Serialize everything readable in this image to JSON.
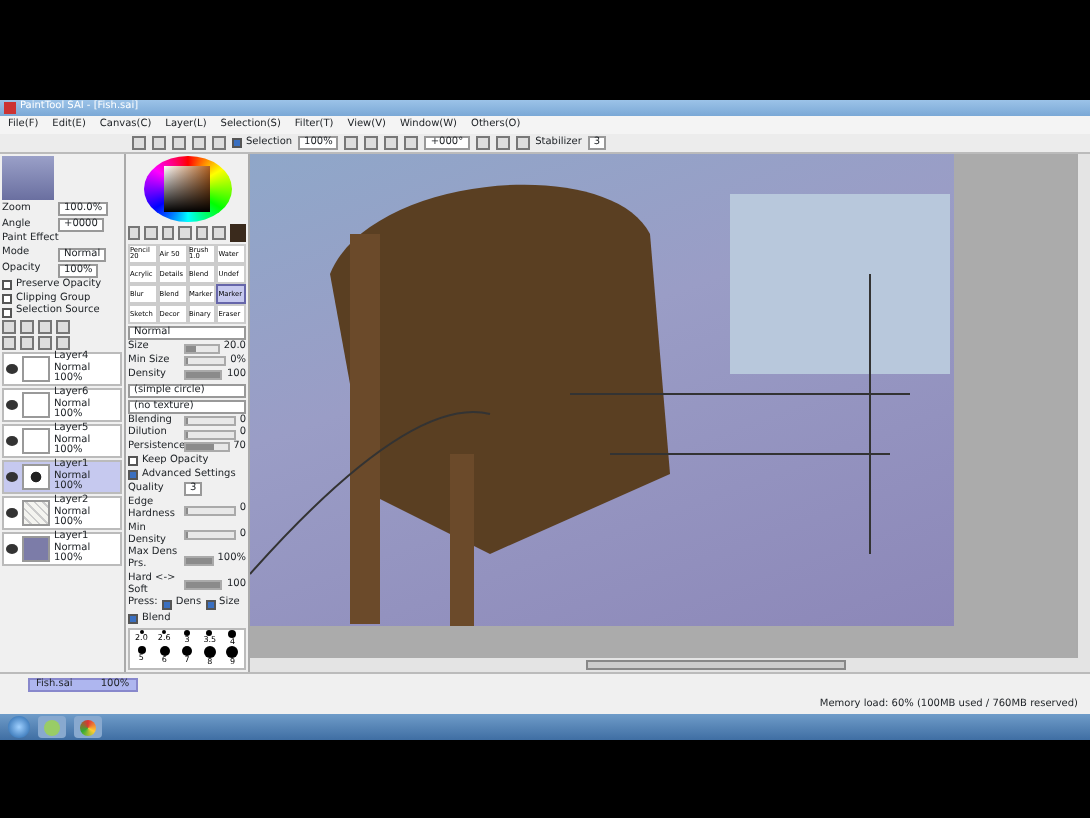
{
  "window": {
    "title": "PaintTool SAI - [Fish.sai]"
  },
  "menu": [
    "File(F)",
    "Edit(E)",
    "Canvas(C)",
    "Layer(L)",
    "Selection(S)",
    "Filter(T)",
    "View(V)",
    "Window(W)",
    "Others(O)"
  ],
  "toolbar": {
    "show_selection": {
      "label": "Selection",
      "checked": true
    },
    "zoom": "100%",
    "angle": "+000°",
    "stabilizer_label": "Stabilizer",
    "stabilizer": "3"
  },
  "navigator": {
    "zoom_label": "Zoom",
    "zoom": "100.0%",
    "angle_label": "Angle",
    "angle": "+0000"
  },
  "layer_panel": {
    "paint_effect": "Paint Effect",
    "mode_label": "Mode",
    "mode": "Normal",
    "opacity_label": "Opacity",
    "opacity": "100%",
    "options": [
      {
        "label": "Preserve Opacity",
        "checked": false
      },
      {
        "label": "Clipping Group",
        "checked": false
      },
      {
        "label": "Selection Source",
        "checked": false
      }
    ]
  },
  "layers": [
    {
      "name": "Layer4",
      "mode": "Normal",
      "opacity": "100%",
      "visible": true,
      "selected": false,
      "kind": "blank"
    },
    {
      "name": "Layer6",
      "mode": "Normal",
      "opacity": "100%",
      "visible": true,
      "selected": false,
      "kind": "blank"
    },
    {
      "name": "Layer5",
      "mode": "Normal",
      "opacity": "100%",
      "visible": true,
      "selected": false,
      "kind": "blank"
    },
    {
      "name": "Layer1",
      "mode": "Normal",
      "opacity": "100%",
      "visible": true,
      "selected": true,
      "kind": "figure"
    },
    {
      "name": "Layer2",
      "mode": "Normal",
      "opacity": "100%",
      "visible": true,
      "selected": false,
      "kind": "sketch"
    },
    {
      "name": "Layer1",
      "mode": "Normal",
      "opacity": "100%",
      "visible": true,
      "selected": false,
      "kind": "fill"
    }
  ],
  "brushes": [
    {
      "name": "Pencil",
      "size": "20",
      "selected": false
    },
    {
      "name": "Air",
      "size": "50",
      "selected": false
    },
    {
      "name": "Brush",
      "size": "1.0",
      "selected": false
    },
    {
      "name": "Water",
      "selected": false
    },
    {
      "name": "Acrylic",
      "selected": false
    },
    {
      "name": "Details",
      "selected": false
    },
    {
      "name": "Blend",
      "selected": false
    },
    {
      "name": "Undef",
      "selected": false
    },
    {
      "name": "Blur",
      "selected": false
    },
    {
      "name": "Blend",
      "selected": false
    },
    {
      "name": "Marker",
      "selected": false
    },
    {
      "name": "Marker",
      "selected": true
    },
    {
      "name": "Sketch",
      "selected": false
    },
    {
      "name": "Decor",
      "selected": false
    },
    {
      "name": "Binary",
      "selected": false
    },
    {
      "name": "Eraser",
      "selected": false
    }
  ],
  "brush_settings": {
    "blend_mode": "Normal",
    "rows": [
      {
        "label": "Size",
        "value": "20.0",
        "level": 0.3
      },
      {
        "label": "Min Size",
        "value": "0%",
        "level": 0
      },
      {
        "label": "Density",
        "value": "100",
        "level": 1
      }
    ],
    "shape": "(simple circle)",
    "texture": "(no texture)",
    "mix": [
      {
        "label": "Blending",
        "value": "0",
        "level": 0
      },
      {
        "label": "Dilution",
        "value": "0",
        "level": 0
      },
      {
        "label": "Persistence",
        "value": "70",
        "level": 0.7
      }
    ],
    "keep_opacity": {
      "label": "Keep Opacity",
      "checked": false
    },
    "advanced": {
      "label": "Advanced Settings",
      "checked": true
    },
    "quality_label": "Quality",
    "quality": "3",
    "advanced_rows": [
      {
        "label": "Edge Hardness",
        "value": "0",
        "level": 0
      },
      {
        "label": "Min Density",
        "value": "0",
        "level": 0
      },
      {
        "label": "Max Dens Prs.",
        "value": "100%",
        "level": 1
      },
      {
        "label": "Hard <-> Soft",
        "value": "100",
        "level": 1
      }
    ],
    "press_label": "Press:",
    "press": [
      {
        "label": "Dens",
        "checked": true
      },
      {
        "label": "Size",
        "checked": true
      },
      {
        "label": "Blend",
        "checked": true
      }
    ],
    "sizes": [
      "2.0",
      "2.6",
      "3",
      "3.5",
      "4",
      "5",
      "6",
      "7",
      "8",
      "9"
    ]
  },
  "document_tab": {
    "name": "Fish.sai",
    "zoom": "100%"
  },
  "status": "Memory load: 60% (100MB used / 760MB reserved)"
}
